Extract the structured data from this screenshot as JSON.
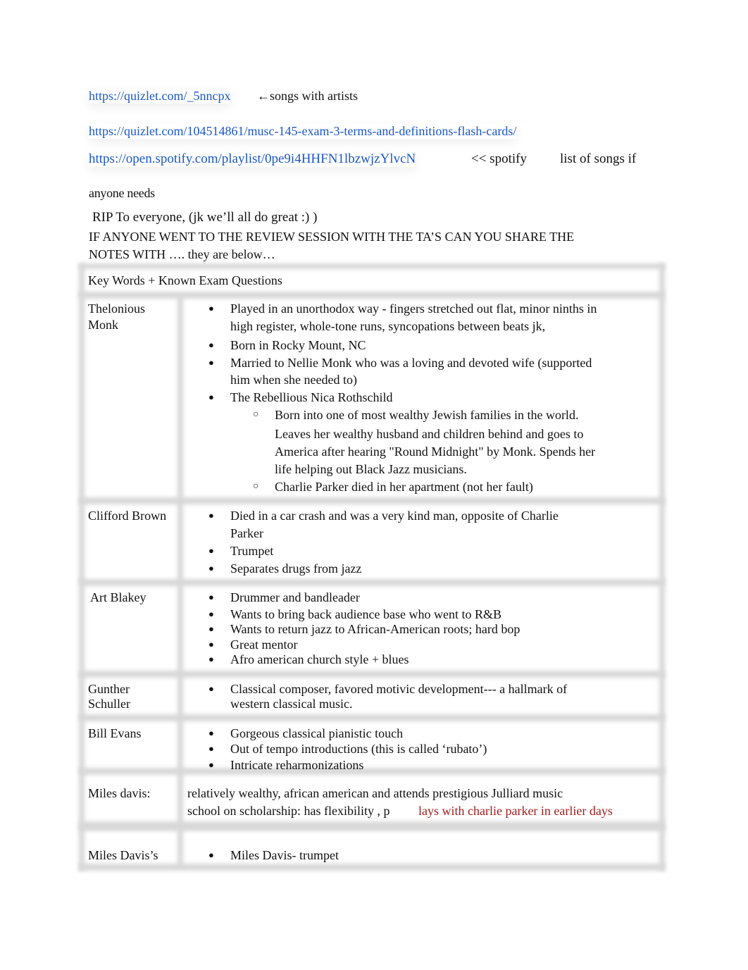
{
  "header_links": [
    {
      "url": "https://quizlet.com/_5nncpx",
      "note": "←songs with artists"
    },
    {
      "url": "https://quizlet.com/104514861/musc-145-exam-3-terms-and-definitions-flash-cards/",
      "note": ""
    },
    {
      "url": "https://open.spotify.com/playlist/0pe9i4HHFN1lbzwjzYlvcN",
      "note_a": "<< spotify",
      "note_b": "list  of songs if"
    }
  ],
  "intro": {
    "line1": "anyone needs",
    "line2": "RIP To everyone, (jk we’ll all do great :) )",
    "line3": "IF ANYONE WENT TO THE REVIEW SESSION WITH THE TA’S CAN YOU SHARE THE",
    "line4": "NOTES WITH ….  they are below…"
  },
  "colors": {
    "link": "#1a57c9",
    "highlight_red": "#a31d1d"
  },
  "table": {
    "header": "Key Words + Known Exam Questions",
    "rows": [
      {
        "name": "Thelonious Monk",
        "name_lines": [
          "Thelonious",
          "Monk"
        ],
        "bullets": [
          "Played in an unorthodox way - fingers stretched out flat, minor ninths in",
          "high register,     whole-tone runs, syncopations between beats jk,",
          "Born in Rocky Mount, NC",
          "Married to Nellie Monk who was a loving and devoted wife (supported",
          "him when she needed to)",
          "The Rebellious Nica Rothschild"
        ],
        "sub_bullets": [
          "Born into one of most wealthy Jewish families in the world.",
          "Leaves her wealthy husband and children behind and goes to",
          "America after hearing \"Round Midnight\" by Monk. Spends her",
          "life helping out Black Jazz musicians.",
          "Charlie Parker died in her apartment (not her fault)"
        ]
      },
      {
        "name": "Clifford Brown",
        "bullets": [
          "Died in a car crash and was a very kind man, opposite of Charlie",
          "Parker",
          "Trumpet",
          "Separates drugs from jazz"
        ]
      },
      {
        "name": "Art Blakey",
        "bullets": [
          "Drummer and bandleader",
          "Wants to bring back audience base who went to R&B",
          "Wants to return jazz to African-American roots; hard bop",
          "Great mentor",
          "Afro american church style + blues"
        ]
      },
      {
        "name": "Gunther Schuller",
        "name_lines": [
          "Gunther",
          "Schuller"
        ],
        "bullets": [
          "Classical composer, favored motivic development--- a hallmark of",
          "western classical music."
        ]
      },
      {
        "name": "Bill Evans",
        "bullets": [
          "Gorgeous classical pianistic touch",
          "Out of tempo introductions (this is called ‘rubato’)",
          "Intricate reharmonizations"
        ]
      },
      {
        "name": "Miles davis:",
        "text_line1": "relatively wealthy, african american and attends prestigious Julliard music",
        "text_line2_black": "school on scholarship: has flexibility , p",
        "text_line2_red": "lays with charlie parker in earlier days"
      },
      {
        "name": "Miles Davis’s",
        "bullets": [
          "Miles Davis- trumpet"
        ]
      }
    ]
  },
  "icons": {
    "bullet": "●",
    "sub_bullet": "○"
  }
}
